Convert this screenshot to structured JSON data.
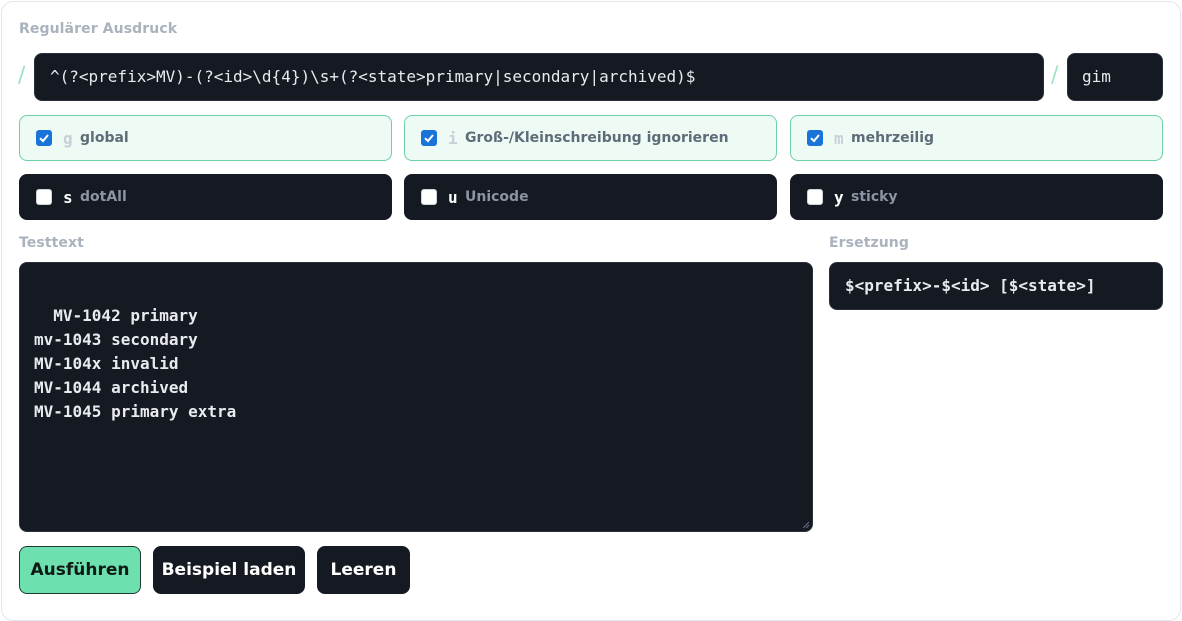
{
  "regex": {
    "label": "Regulärer Ausdruck",
    "slash_open": "/",
    "slash_close": "/",
    "pattern": "^(?<prefix>MV)-(?<id>\\d{4})\\s+(?<state>primary|secondary|archived)$",
    "flags_value": "gim"
  },
  "flags": [
    {
      "letter": "g",
      "name": "global",
      "checked": true
    },
    {
      "letter": "i",
      "name": "Groß-/Kleinschreibung ignorieren",
      "checked": true
    },
    {
      "letter": "m",
      "name": "mehrzeilig",
      "checked": true
    },
    {
      "letter": "s",
      "name": "dotAll",
      "checked": false
    },
    {
      "letter": "u",
      "name": "Unicode",
      "checked": false
    },
    {
      "letter": "y",
      "name": "sticky",
      "checked": false
    }
  ],
  "testtext": {
    "label": "Testtext",
    "value": "MV-1042 primary\nmv-1043 secondary\nMV-104x invalid\nMV-1044 archived\nMV-1045 primary extra"
  },
  "replacement": {
    "label": "Ersetzung",
    "value": "$<prefix>-$<id> [$<state>]"
  },
  "buttons": {
    "run": "Ausführen",
    "example": "Beispiel laden",
    "clear": "Leeren"
  },
  "colors": {
    "accent": "#6ee0b0",
    "checkbox": "#1a73d9",
    "dark_field": "#141922"
  }
}
